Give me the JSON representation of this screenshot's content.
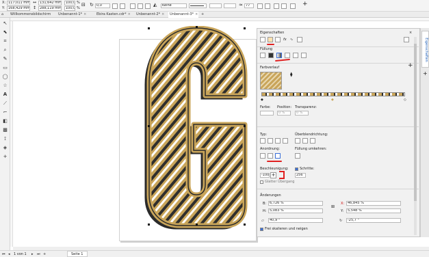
{
  "propbar": {
    "x_label": "X:",
    "x_value": "117,011 mm",
    "y_label": "Y:",
    "y_value": "168,429 mm",
    "width_value": "131,642 mm",
    "height_value": "288,119 mm",
    "scale_x": "100,0",
    "scale_y": "100,0",
    "percent": "%",
    "rotation": "0,0",
    "outline_style": "Keine",
    "outline_width": "77"
  },
  "tabs": [
    {
      "label": "Willkommensbildschirm"
    },
    {
      "label": "Unbenannt-1*"
    },
    {
      "label": "Ebira Kasten.cdr*"
    },
    {
      "label": "Unbenannt-2*"
    },
    {
      "label": "Unbenannt-3*"
    }
  ],
  "docker": {
    "title": "Eigenschaften",
    "fill_section": "Füllung",
    "gradient_label": "Farbverlauf",
    "color_label": "Farbe:",
    "position_label": "Position:",
    "position_value": "0 %",
    "transparency_label": "Transparenz:",
    "transparency_value": "0 %",
    "type_label": "Typ:",
    "overprint_label": "Überblendrichtung:",
    "arrangement_label": "Anordnung:",
    "invert_label": "Füllung umkehren:",
    "acceleration_label": "Beschleunigung:",
    "acceleration_value": "-100,0",
    "steps_label": "Schritte:",
    "steps_value": "256",
    "smooth_label": "Glatter Übergang",
    "changes_label": "Änderungen",
    "b_label": "B:",
    "b_value": "6,726 %",
    "h_label": "H:",
    "h_value": "5,083 %",
    "x_label": "X:",
    "x_value": "46,845 %",
    "y_label": "Y:",
    "y_value": "5,548 %",
    "rotate_value": "40,9 °",
    "skew_value": "-25,7 °",
    "freely_label": "Frei skalieren und neigen"
  },
  "vtab": {
    "label": "Eigenschaften"
  },
  "status": {
    "page_info": "1 von 1",
    "page_tab": "Seite 1"
  },
  "colors": {
    "gold": "#c9a55a",
    "dark": "#2b2b2b",
    "accent_red": "#e02020"
  }
}
